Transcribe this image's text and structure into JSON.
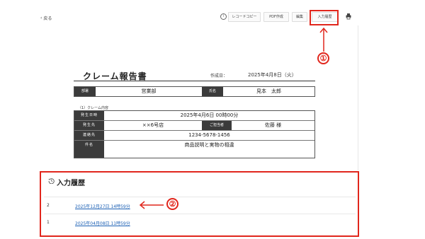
{
  "toolbar": {
    "back_label": "戻る",
    "info_icon": "info-icon",
    "record_copy_label": "レコードコピー",
    "pdf_label": "PDF作成",
    "edit_label": "編集",
    "history_label": "入力履歴",
    "print_icon": "printer-icon"
  },
  "annotations": {
    "marker1": "①",
    "marker2": "②",
    "color": "#e1261c"
  },
  "report": {
    "title": "クレーム報告書",
    "date_label": "作成日：",
    "date_value": "2025年4月8日（火）",
    "dept_label": "部署",
    "dept_value": "営業部",
    "name_label": "氏名",
    "name_value": "見本　太郎",
    "section_label": "（1）クレーム内容",
    "rows": [
      {
        "label": "発生日時",
        "value": "2025年4月6日 00時00分"
      },
      {
        "label": "発生先",
        "value": "××6号店",
        "label2": "ご担当者",
        "value2": "佐藤 様"
      },
      {
        "label": "連絡先",
        "value": "1234-5678-1456"
      },
      {
        "label": "件名",
        "value": "商品説明と実物の相違"
      }
    ]
  },
  "history": {
    "title": "入力履歴",
    "entries": [
      {
        "index": "2",
        "timestamp": "2025年12月27日 14時59分"
      },
      {
        "index": "1",
        "timestamp": "2025年04月08日 11時59分"
      }
    ]
  }
}
